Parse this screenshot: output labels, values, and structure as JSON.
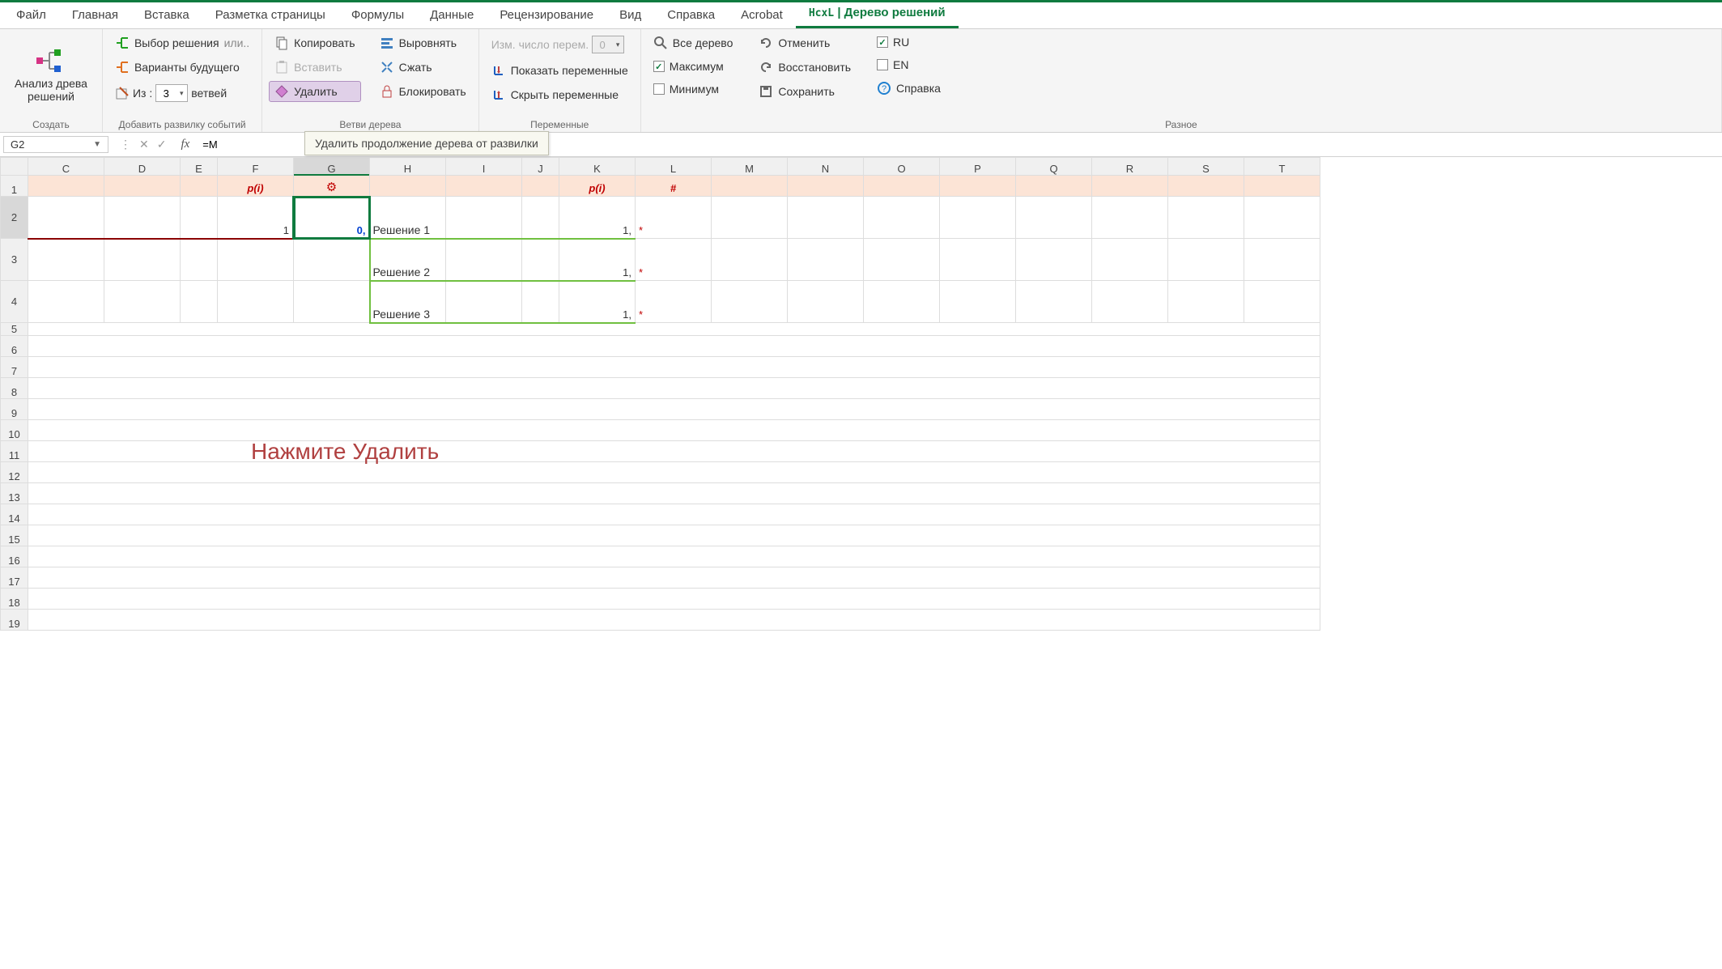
{
  "tabs": {
    "file": "Файл",
    "home": "Главная",
    "insert": "Вставка",
    "layout": "Разметка страницы",
    "formulas": "Формулы",
    "data": "Данные",
    "review": "Рецензирование",
    "view": "Вид",
    "help": "Справка",
    "acrobat": "Acrobat",
    "active_prefix": "HcxL",
    "active": "| Дерево решений"
  },
  "ribbon": {
    "create": {
      "big_btn_l1": "Анализ древа",
      "big_btn_l2": "решений",
      "label": "Создать"
    },
    "fork": {
      "choose": "Выбор решения",
      "choose_sfx": "или..",
      "future": "Варианты будущего",
      "from": "Из :",
      "from_val": "3",
      "branches": "ветвей",
      "label": "Добавить развилку событий"
    },
    "branches": {
      "copy": "Копировать",
      "paste": "Вставить",
      "delete": "Удалить",
      "align": "Выровнять",
      "shrink": "Сжать",
      "lock": "Блокировать",
      "label": "Ветви дерева"
    },
    "vars": {
      "change": "Изм. число перем.",
      "change_val": "0",
      "show": "Показать переменные",
      "hide": "Скрыть переменные",
      "label": "Переменные"
    },
    "other": {
      "full": "Все дерево",
      "max": "Максимум",
      "min": "Минимум",
      "undo": "Отменить",
      "redo": "Восстановить",
      "save": "Сохранить",
      "ru": "RU",
      "en": "EN",
      "help": "Справка",
      "label": "Разное"
    }
  },
  "fbar": {
    "cell": "G2",
    "formula": "=М",
    "tooltip": "Удалить продолжение дерева от развилки"
  },
  "grid": {
    "cols": [
      "C",
      "D",
      "E",
      "F",
      "G",
      "H",
      "I",
      "J",
      "K",
      "L",
      "M",
      "N",
      "O",
      "P",
      "Q",
      "R",
      "S",
      "T"
    ],
    "rows": [
      "1",
      "2",
      "3",
      "4",
      "5",
      "6",
      "7",
      "8",
      "9",
      "10",
      "11",
      "12",
      "13",
      "14",
      "15",
      "16",
      "17",
      "18",
      "19"
    ],
    "headers": {
      "F1": "p(i)",
      "G1": "⚙",
      "K1": "p(i)",
      "L1": "#"
    },
    "r2": {
      "F": "1",
      "G": "0,",
      "H": "Решение 1",
      "K": "1,",
      "L": "*"
    },
    "r3": {
      "H": "Решение 2",
      "K": "1,",
      "L": "*"
    },
    "r4": {
      "H": "Решение 3",
      "K": "1,",
      "L": "*"
    }
  },
  "instruction": "Нажмите Удалить"
}
